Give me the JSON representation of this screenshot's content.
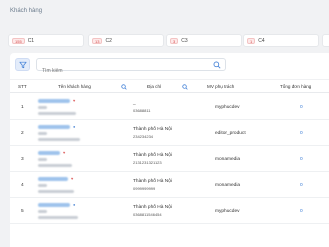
{
  "page": {
    "title": "Khách hàng"
  },
  "chips": [
    {
      "badge": "155",
      "label": "C1"
    },
    {
      "badge": "13",
      "label": "C2"
    },
    {
      "badge": "3",
      "label": "C3"
    },
    {
      "badge": "1",
      "label": "C4"
    },
    {
      "badge": "",
      "label": ""
    }
  ],
  "search": {
    "placeholder": "Tìm kiếm"
  },
  "table": {
    "headers": {
      "stt": "STT",
      "name": "Tên khách hàng",
      "address": "Địa chỉ",
      "mv": "MV phụ trách",
      "total": "Tổng đơn hàng"
    },
    "rows": [
      {
        "stt": "1",
        "address": "_",
        "phone": "03688811",
        "mv": "myphucdev",
        "total": "0"
      },
      {
        "stt": "2",
        "address": "Thành phố Hà Nội",
        "phone": "234234234",
        "mv": "editor_product",
        "total": "0"
      },
      {
        "stt": "3",
        "address": "Thành phố Hà Nội",
        "phone": "2131231321123",
        "mv": "monamedia",
        "total": "0"
      },
      {
        "stt": "4",
        "address": "Thành phố Hà Nội",
        "phone": "0999999999",
        "mv": "monamedia",
        "total": "0"
      },
      {
        "stt": "5",
        "address": "Thành phố Hà Nội",
        "phone": "0368811546454",
        "mv": "myphucdev",
        "total": "0"
      }
    ]
  },
  "colors": {
    "accent": "#3a7bd5",
    "badge": "#d64c4c",
    "background": "#f1f2f4"
  },
  "icons": {
    "filter": "filter-icon",
    "search": "search-icon"
  }
}
